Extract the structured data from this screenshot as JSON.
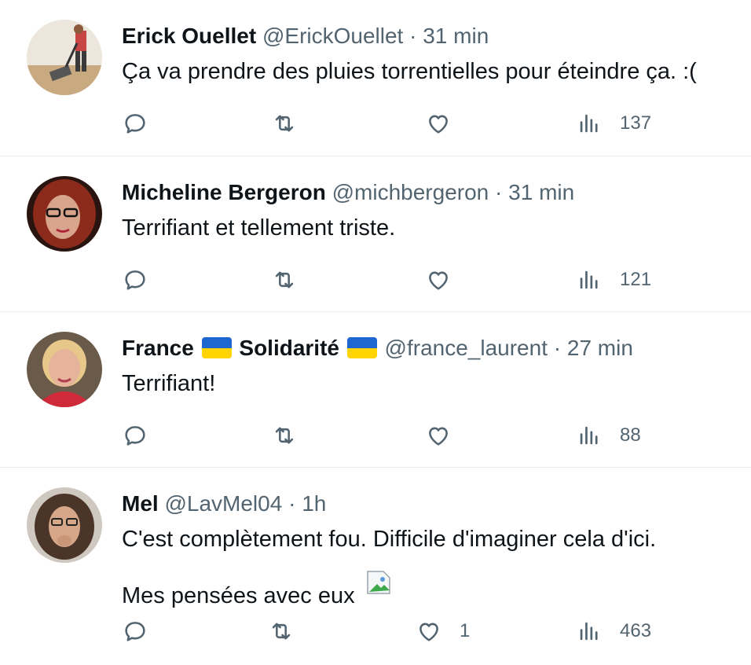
{
  "colors": {
    "text": "#0f1419",
    "muted": "#536471",
    "divider": "#e8ecee",
    "ukraine_blue": "#1e66d0",
    "ukraine_yellow": "#ffd400"
  },
  "icons": {
    "reply": "speech-bubble-icon",
    "retweet": "retweet-icon",
    "like": "heart-icon",
    "views": "bar-chart-icon",
    "flag": "ukraine-flag-icon",
    "image": "broken-image-icon"
  },
  "tweets": [
    {
      "name": "Erick Ouellet",
      "handle": "@ErickOuellet",
      "time": "31 min",
      "text": "Ça va prendre des pluies torrentielles pour éteindre ça. :(",
      "likes": "",
      "views": "137"
    },
    {
      "name": "Micheline Bergeron",
      "handle": "@michbergeron",
      "time": "31 min",
      "text": "Terrifiant et tellement triste.",
      "likes": "",
      "views": "121"
    },
    {
      "name_part1": "France",
      "name_part2": "Solidarité",
      "handle": "@france_laurent",
      "time": "27 min",
      "text": "Terrifiant!",
      "likes": "",
      "views": "88"
    },
    {
      "name": "Mel",
      "handle": "@LavMel04",
      "time": "1h",
      "text": "C'est complètement fou. Difficile d'imaginer cela d'ici.",
      "text2": "Mes pensées avec eux",
      "likes": "1",
      "views": "463"
    }
  ],
  "separator": "·"
}
